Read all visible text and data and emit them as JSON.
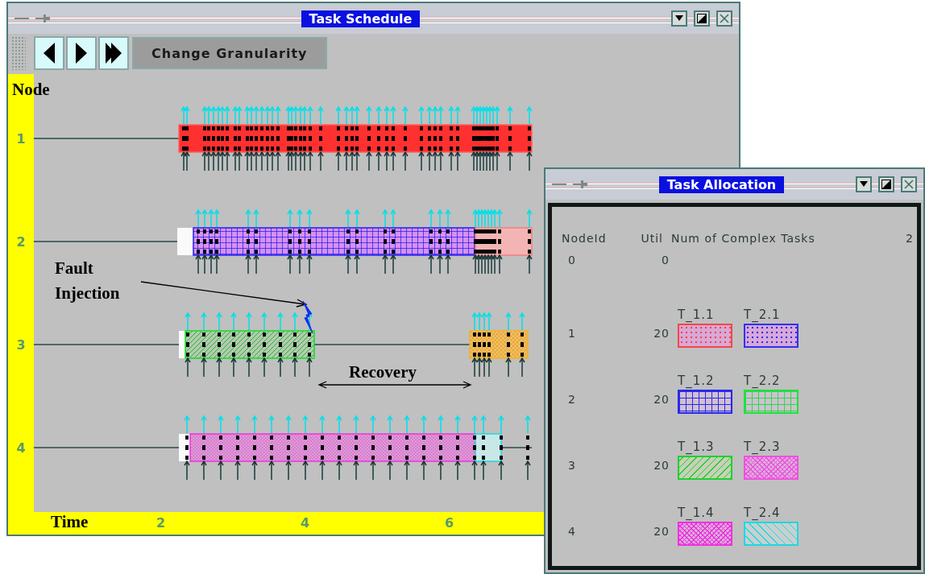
{
  "schedule_window": {
    "title": "Task Schedule",
    "toolbar": {
      "nav_buttons": [
        {
          "kind": "back"
        },
        {
          "kind": "forward"
        },
        {
          "kind": "end"
        }
      ],
      "granularity_button": "Change Granularity"
    },
    "plot": {
      "y_title": "Node",
      "nodes": [
        "1",
        "2",
        "3",
        "4"
      ],
      "x_title": "Time",
      "x_ticks": [
        "2",
        "4",
        "6"
      ]
    },
    "annotations": [
      {
        "kind": "fault",
        "label": "Fault Injection"
      },
      {
        "kind": "recovery",
        "label": "Recovery"
      }
    ]
  },
  "allocation_window": {
    "title": "Task Allocation",
    "columns": [
      "NodeId",
      "Util",
      "Num of Complex Tasks"
    ],
    "task_count": "2",
    "rows": [
      {
        "node": "0",
        "util": "0"
      },
      {
        "node": "1",
        "util": "20",
        "tasks": [
          {
            "label": "T_1.1",
            "color": "#f04848",
            "kind": "dots"
          },
          {
            "label": "T_2.1",
            "color": "#3030f0",
            "kind": "dots"
          }
        ]
      },
      {
        "node": "2",
        "util": "20",
        "tasks": [
          {
            "label": "T_1.2",
            "color": "#2828f0",
            "kind": "grid"
          },
          {
            "label": "T_2.2",
            "color": "#20e040",
            "kind": "grid"
          }
        ]
      },
      {
        "node": "3",
        "util": "20",
        "tasks": [
          {
            "label": "T_1.3",
            "color": "#20d030",
            "kind": "hatch"
          },
          {
            "label": "T_2.3",
            "color": "#f050e0",
            "kind": "crosshatch"
          }
        ]
      },
      {
        "node": "4",
        "util": "20",
        "tasks": [
          {
            "label": "T_1.4",
            "color": "#f030e0",
            "kind": "crosshatch"
          },
          {
            "label": "T_2.4",
            "color": "#20d8e0",
            "kind": "backhatch"
          }
        ]
      }
    ]
  }
}
